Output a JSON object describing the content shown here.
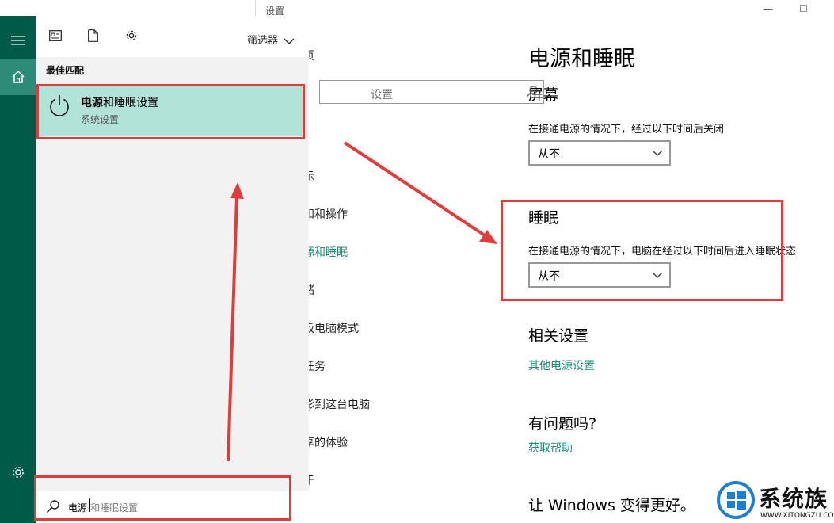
{
  "settings": {
    "window_title": "设置",
    "nav_search_placeholder": "设置",
    "nav_fragments": [
      "页",
      "示",
      "知和操作",
      "源和睡眠",
      "储",
      "板电脑模式",
      "任务",
      "影到这台电脑",
      "享的体验",
      "于"
    ],
    "page_title": "电源和睡眠",
    "screen": {
      "heading": "屏幕",
      "desc": "在接通电源的情况下，经过以下时间后关闭",
      "value": "从不"
    },
    "sleep": {
      "heading": "睡眠",
      "desc": "在接通电源的情况下，电脑在经过以下时间后进入睡眠状态",
      "value": "从不"
    },
    "related": {
      "heading": "相关设置",
      "link": "其他电源设置"
    },
    "help": {
      "heading": "有问题吗?",
      "link": "获取帮助"
    },
    "better": {
      "heading": "让 Windows 变得更好。"
    }
  },
  "start_menu": {
    "filter_label": "筛选器",
    "best_match_label": "最佳匹配",
    "result": {
      "title_bold": "电源",
      "title_rest": "和睡眠设置",
      "subtitle": "系统设置"
    },
    "search": {
      "typed": "电源",
      "suggestion": "和睡眠设置"
    }
  },
  "annotation_color": "#e03c3c",
  "accent_color": "#1a8c76",
  "rail_color": "#005a48",
  "watermark": {
    "text": "系统族",
    "url": "WWW.XITONGZU.COM"
  },
  "icons": [
    "hamburger-icon",
    "home-icon",
    "gear-icon",
    "apps-icon",
    "document-icon",
    "power-icon",
    "search-icon",
    "chevron-down-icon"
  ]
}
